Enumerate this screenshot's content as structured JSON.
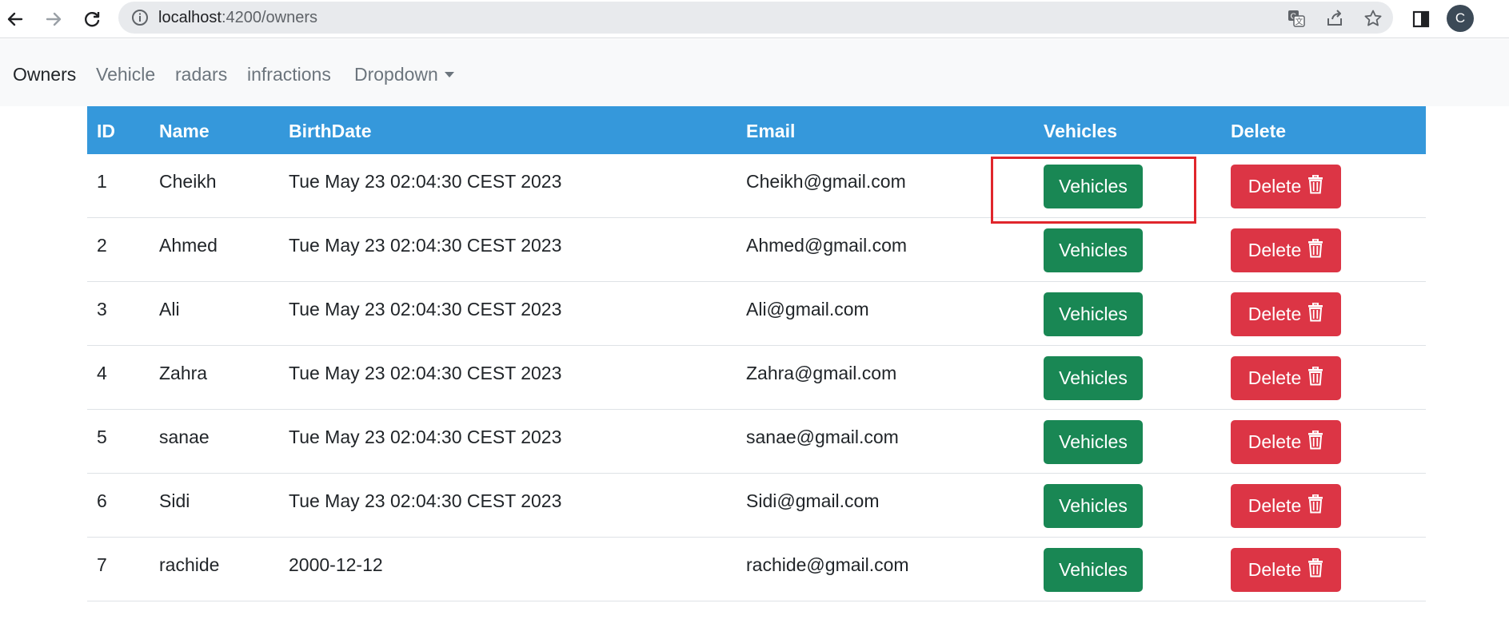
{
  "browser": {
    "url_host": "localhost",
    "url_path": ":4200/owners",
    "profile_initial": "C"
  },
  "navbar": {
    "items": [
      {
        "label": "Owners",
        "active": true
      },
      {
        "label": "Vehicle",
        "active": false
      },
      {
        "label": "radars",
        "active": false
      },
      {
        "label": "infractions",
        "active": false
      }
    ],
    "dropdown_label": "Dropdown"
  },
  "table": {
    "headers": [
      "ID",
      "Name",
      "BirthDate",
      "Email",
      "Vehicles",
      "Delete"
    ],
    "rows": [
      {
        "id": "1",
        "name": "Cheikh",
        "birthdate": "Tue May 23 02:04:30 CEST 2023",
        "email": "Cheikh@gmail.com",
        "vehicles_label": "Vehicles",
        "delete_label": "Delete"
      },
      {
        "id": "2",
        "name": "Ahmed",
        "birthdate": "Tue May 23 02:04:30 CEST 2023",
        "email": "Ahmed@gmail.com",
        "vehicles_label": "Vehicles",
        "delete_label": "Delete"
      },
      {
        "id": "3",
        "name": "Ali",
        "birthdate": "Tue May 23 02:04:30 CEST 2023",
        "email": "Ali@gmail.com",
        "vehicles_label": "Vehicles",
        "delete_label": "Delete"
      },
      {
        "id": "4",
        "name": "Zahra",
        "birthdate": "Tue May 23 02:04:30 CEST 2023",
        "email": "Zahra@gmail.com",
        "vehicles_label": "Vehicles",
        "delete_label": "Delete"
      },
      {
        "id": "5",
        "name": "sanae",
        "birthdate": "Tue May 23 02:04:30 CEST 2023",
        "email": "sanae@gmail.com",
        "vehicles_label": "Vehicles",
        "delete_label": "Delete"
      },
      {
        "id": "6",
        "name": "Sidi",
        "birthdate": "Tue May 23 02:04:30 CEST 2023",
        "email": "Sidi@gmail.com",
        "vehicles_label": "Vehicles",
        "delete_label": "Delete"
      },
      {
        "id": "7",
        "name": "rachide",
        "birthdate": "2000-12-12",
        "email": "rachide@gmail.com",
        "vehicles_label": "Vehicles",
        "delete_label": "Delete"
      }
    ]
  },
  "colors": {
    "header_bg": "#3598db",
    "vehicles_button": "#198754",
    "delete_button": "#dc3545",
    "highlight_box": "#e0262c"
  },
  "icons": {
    "delete_button_icon": "trash-icon"
  }
}
